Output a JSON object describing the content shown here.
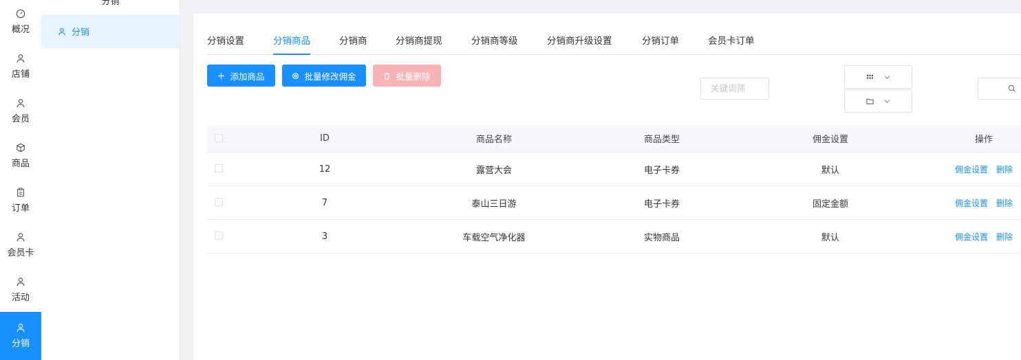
{
  "nav": {
    "items": [
      {
        "label": "概况",
        "icon": "gauge-icon"
      },
      {
        "label": "店铺",
        "icon": "user-icon"
      },
      {
        "label": "会员",
        "icon": "user-icon"
      },
      {
        "label": "商品",
        "icon": "box-icon"
      },
      {
        "label": "订单",
        "icon": "clipboard-icon"
      },
      {
        "label": "会员卡",
        "icon": "user-icon"
      },
      {
        "label": "活动",
        "icon": "user-icon"
      },
      {
        "label": "分销",
        "icon": "user-icon"
      }
    ],
    "active_index": 7,
    "accent": "#1890ff"
  },
  "subnav": {
    "title": "分销",
    "item_label": "分销"
  },
  "tabs": [
    "分销设置",
    "分销商品",
    "分销商",
    "分销商提现",
    "分销商等级",
    "分销商升级设置",
    "分销订单",
    "会员卡订单"
  ],
  "active_tab": 1,
  "toolbar": {
    "add_label": "添加商品",
    "batch_commission_label": "批量修改佣金",
    "batch_delete_label": "批量删除"
  },
  "filters": {
    "keyword_placeholder": "关键词筛"
  },
  "table": {
    "headers": {
      "id": "ID",
      "name": "商品名称",
      "type": "商品类型",
      "commission": "佣金设置",
      "ops": "操作"
    },
    "rows": [
      {
        "id": "12",
        "name": "露营大会",
        "type": "电子卡券",
        "commission": "默认"
      },
      {
        "id": "7",
        "name": "泰山三日游",
        "type": "电子卡券",
        "commission": "固定金额"
      },
      {
        "id": "3",
        "name": "车载空气净化器",
        "type": "实物商品",
        "commission": "默认"
      }
    ],
    "op_commission": "佣金设置",
    "op_delete": "删除"
  }
}
